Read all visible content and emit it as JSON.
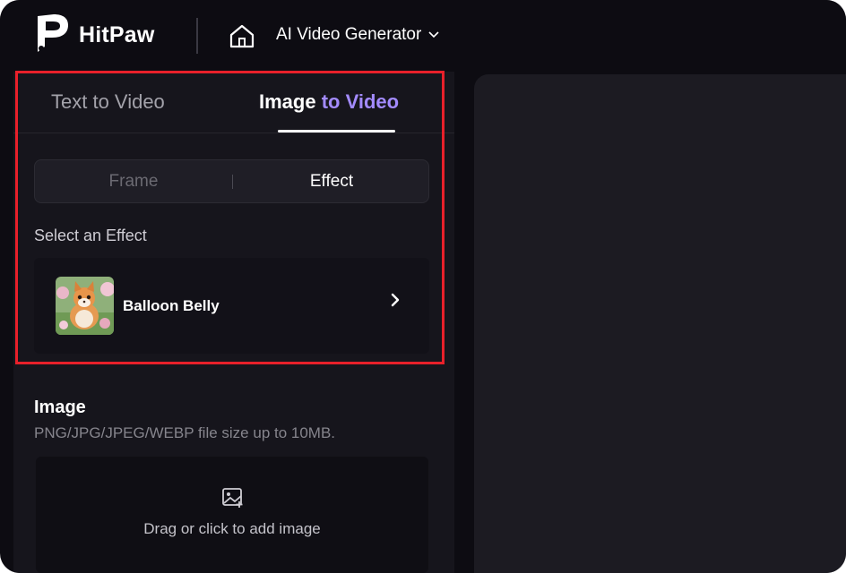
{
  "header": {
    "brand": "HitPaw",
    "app_selector": "AI Video Generator",
    "icons": [
      "hitpaw-logo-icon",
      "home-icon",
      "chevron-down-icon"
    ]
  },
  "tabs": {
    "text_to_video": "Text to Video",
    "image_to_video_part1": "Image",
    "image_to_video_part2": "to Video",
    "active": "Image to Video"
  },
  "mode": {
    "frame": "Frame",
    "effect": "Effect",
    "active": "Effect"
  },
  "effect_section": {
    "label": "Select an Effect",
    "selected_effect": "Balloon Belly"
  },
  "image_section": {
    "title": "Image",
    "hint": "PNG/JPG/JPEG/WEBP file size up to 10MB.",
    "upload_text": "Drag or click to add image"
  },
  "colors": {
    "background": "#0d0c12",
    "panel": "#16151c",
    "accent_purple": "#a38bff",
    "highlight_red": "#e8202a"
  }
}
